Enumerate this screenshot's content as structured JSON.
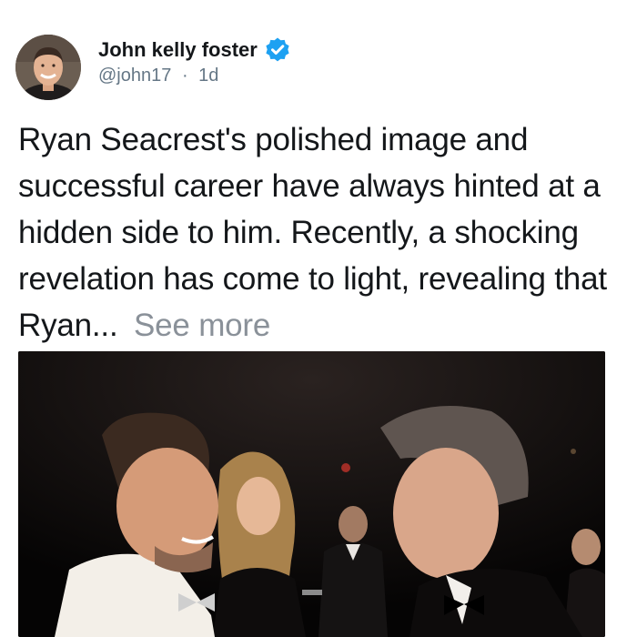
{
  "author": {
    "name": "John kelly foster",
    "handle": "@john17",
    "separator": "·",
    "time": "1d",
    "verified_icon": "verified-badge-icon",
    "accent_color": "#1da1f2"
  },
  "post": {
    "text": "Ryan Seacrest's polished image and successful career have always hinted at a hidden side to him. Recently, a shocking revelation has come to light, revealing that Ryan...",
    "see_more_label": "See more"
  },
  "media": {
    "icon": "photo-image"
  }
}
